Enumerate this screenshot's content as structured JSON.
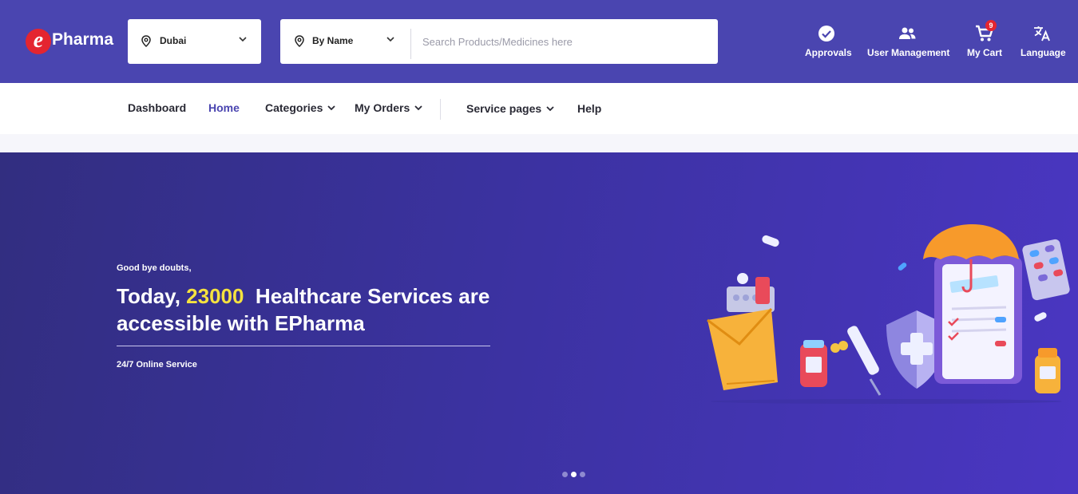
{
  "brand": {
    "logo_letter": "e",
    "logo_text": "Pharma"
  },
  "location": {
    "value": "Dubai"
  },
  "search": {
    "type_value": "By Name",
    "placeholder": "Search Products/Medicines here",
    "value": ""
  },
  "header_actions": [
    {
      "label": "Approvals",
      "icon": "check-circle-icon"
    },
    {
      "label": "User Management",
      "icon": "users-icon"
    },
    {
      "label": "My Cart",
      "icon": "cart-icon",
      "badge": "9"
    },
    {
      "label": "Language",
      "icon": "translate-icon"
    }
  ],
  "nav": {
    "dashboard": "Dashboard",
    "home": "Home",
    "categories": "Categories",
    "my_orders": "My Orders",
    "service_pages": "Service pages",
    "help": "Help",
    "active": "Home"
  },
  "hero": {
    "kicker": "Good bye doubts,",
    "headline_pre": "Today, ",
    "headline_number": "23000",
    "headline_post": "  Healthcare Services are accessible with EPharma",
    "sub": "24/7 Online Service",
    "slides_total": 3,
    "slide_active": 2
  },
  "colors": {
    "header_bg": "#4a45b0",
    "accent": "#4a45b0",
    "logo_red": "#e42530",
    "highlight_yellow": "#f5e23f"
  }
}
